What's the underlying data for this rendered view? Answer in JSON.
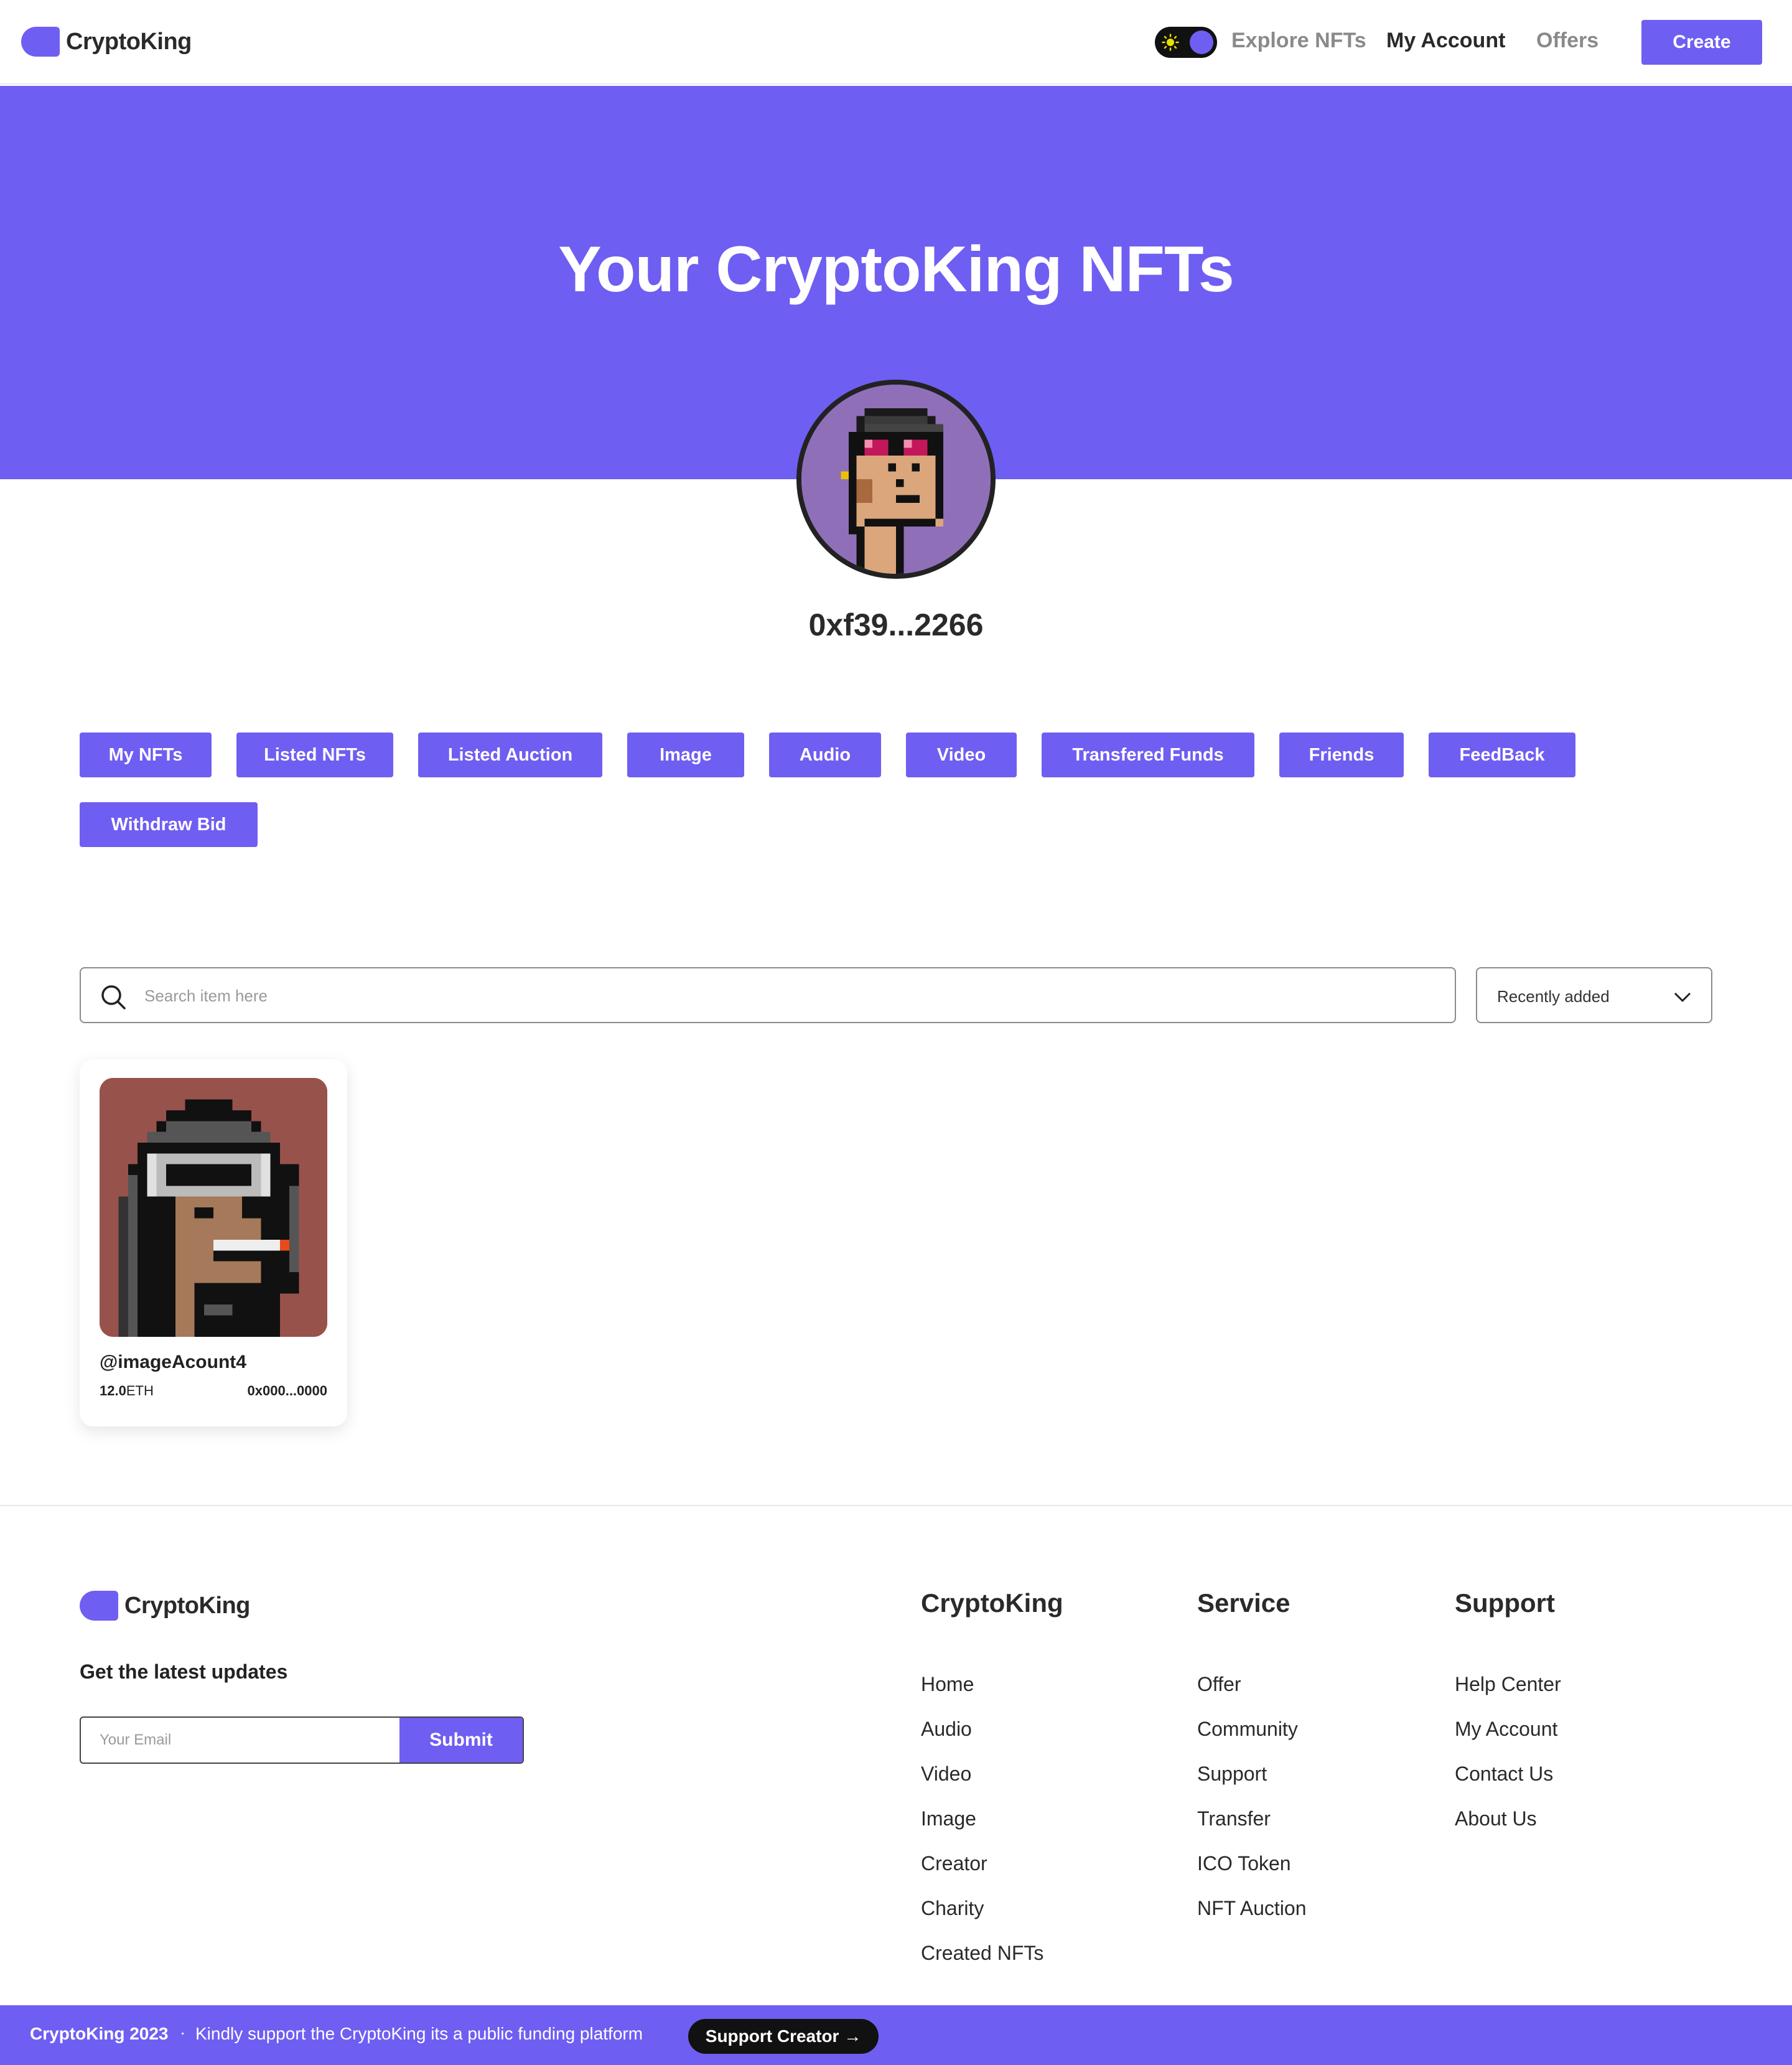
{
  "header": {
    "brand": "CryptoKing",
    "nav": [
      "Explore NFTs",
      "My Account",
      "Offers"
    ],
    "active_nav": "My Account",
    "create_label": "Create",
    "theme_toggle": "light-mode-sun-icon"
  },
  "hero": {
    "title": "Your CryptoKing NFTs",
    "address": "0xf39...2266"
  },
  "tabs": [
    "My NFTs",
    "Listed NFTs",
    "Listed Auction",
    "Image",
    "Audio",
    "Video",
    "Transfered Funds",
    "Friends",
    "FeedBack",
    "Withdraw Bid"
  ],
  "search": {
    "placeholder": "Search item here",
    "sort_value": "Recently added"
  },
  "nfts": [
    {
      "name": "@imageAcount4",
      "price": "12.0",
      "currency": "ETH",
      "owner": "0x000...0000"
    }
  ],
  "footer": {
    "brand": "CryptoKing",
    "tagline": "Get the latest updates",
    "email_placeholder": "Your Email",
    "submit_label": "Submit",
    "columns": [
      {
        "title": "CryptoKing",
        "links": [
          "Home",
          "Audio",
          "Video",
          "Image",
          "Creator",
          "Charity",
          "Created NFTs"
        ]
      },
      {
        "title": "Service",
        "links": [
          "Offer",
          "Community",
          "Support",
          "Transfer",
          "ICO Token",
          "NFT Auction"
        ]
      },
      {
        "title": "Support",
        "links": [
          "Help Center",
          "My Account",
          "Contact Us",
          "About Us"
        ]
      }
    ]
  },
  "bottom_bar": {
    "brand": "CryptoKing 2023",
    "separator": "·",
    "message": "Kindly support the CryptoKing its a public funding platform",
    "button_label": "Support Creator →"
  },
  "colors": {
    "accent": "#6f5ef2",
    "text": "#2a2a2a",
    "nav_muted": "#8a8a8a",
    "card_bg": "#98524c"
  }
}
